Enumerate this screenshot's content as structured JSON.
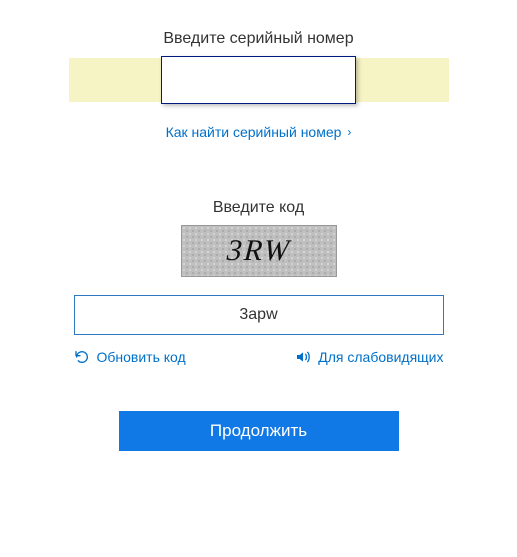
{
  "serial": {
    "label": "Введите серийный номер",
    "value": "",
    "help_text": "Как найти серийный номер"
  },
  "captcha": {
    "label": "Введите код",
    "image_text": "3RW",
    "input_value": "3apw",
    "refresh_label": "Обновить код",
    "accessibility_label": "Для слабовидящих"
  },
  "submit": {
    "label": "Продолжить"
  }
}
